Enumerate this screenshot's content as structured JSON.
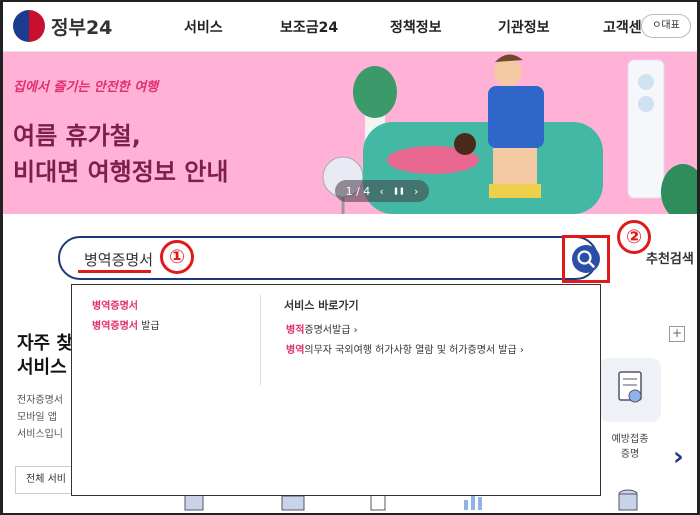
{
  "header": {
    "logo_text": "정부24",
    "nav": [
      "서비스",
      "보조금24",
      "정책정보",
      "기관정보",
      "고객센터"
    ],
    "sites_button": "ㅇ대표"
  },
  "banner": {
    "tagline": "집에서 즐기는 안전한 여행",
    "title_line1": "여름 휴가철,",
    "title_line2": "비대면 여행정보 안내",
    "page_indicator": "1 / 4",
    "prev": "‹",
    "pause": "❚❚",
    "next": "›"
  },
  "search": {
    "query": "병역증명서",
    "badge1": "①",
    "badge2": "②",
    "recommend_label": "추천검색"
  },
  "dropdown": {
    "suggestions": [
      {
        "highlight": "병역증명서",
        "rest": ""
      },
      {
        "highlight": "병역증명서",
        "rest": " 발급"
      }
    ],
    "shortcut_heading": "서비스 바로가기",
    "shortcuts": [
      {
        "highlight": "병적",
        "rest": "증명서발급 ›"
      },
      {
        "highlight": "병역",
        "rest": "의무자 국외여행 허가사항 열람 및 허가증명서 발급 ›"
      }
    ]
  },
  "faq": {
    "title_line1": "자주 찾",
    "title_line2": "서비스",
    "desc_lines": [
      "전자증명서",
      "모바일 앱",
      "서비스입니"
    ],
    "all_button": "전체 서비",
    "plus": "+"
  },
  "card": {
    "label_line1": "예방접종",
    "label_line2": "증명"
  },
  "colors": {
    "brand_navy": "#1d3a78",
    "banner_pink": "#ffb2d6",
    "highlight_pink": "#e0306f",
    "annotation_red": "#e01a1a"
  }
}
